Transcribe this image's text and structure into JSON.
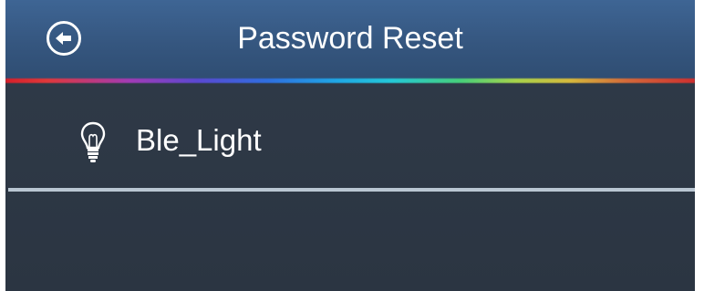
{
  "header": {
    "title": "Password Reset",
    "back_icon": "back-arrow-circle-icon"
  },
  "devices": [
    {
      "name": "Ble_Light",
      "icon": "lightbulb-icon"
    }
  ],
  "colors": {
    "header_top": "#3e6594",
    "header_bottom": "#2f4d72",
    "background": "#2e3947",
    "text": "#ffffff",
    "divider": "#b9c6d2"
  }
}
